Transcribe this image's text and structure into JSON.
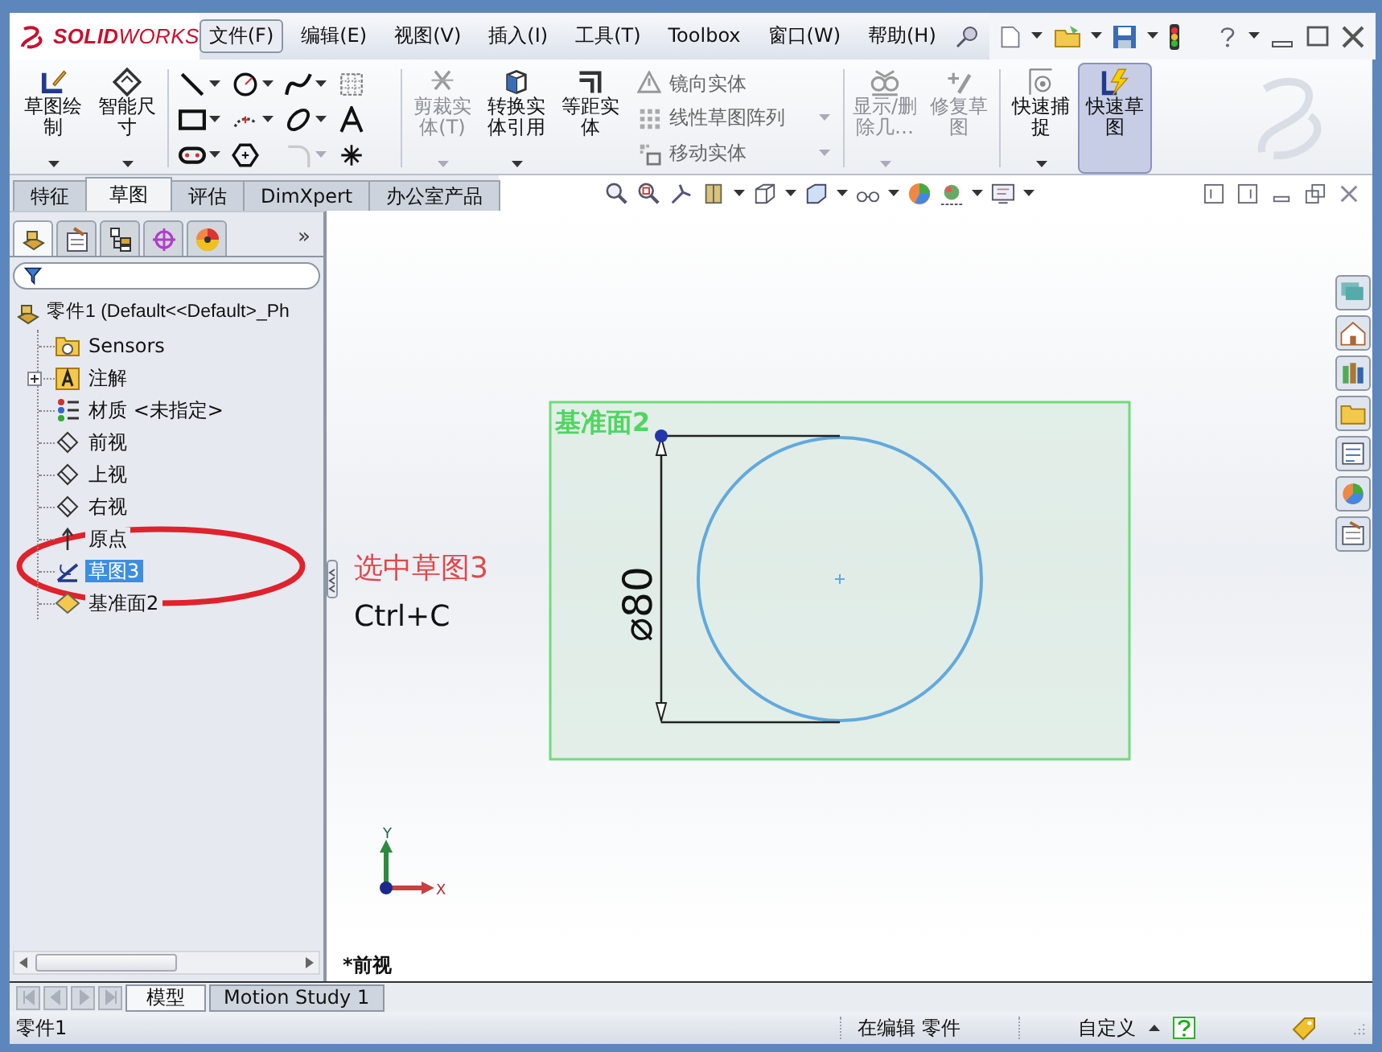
{
  "logo": {
    "text": "**SOLID**WORKS"
  },
  "menu": [
    {
      "label": "文件(F)",
      "selected": true
    },
    {
      "label": "编辑(E)",
      "selected": false
    },
    {
      "label": "视图(V)",
      "selected": false
    },
    {
      "label": "插入(I)",
      "selected": false
    },
    {
      "label": "工具(T)",
      "selected": false
    },
    {
      "label": "Toolbox",
      "selected": false
    },
    {
      "label": "窗口(W)",
      "selected": false
    },
    {
      "label": "帮助(H)",
      "selected": false
    }
  ],
  "command_groups": [
    [
      {
        "kind": "large",
        "label": "草图绘制",
        "caret": true,
        "disabled": false,
        "selected": false
      },
      {
        "kind": "large",
        "label": "智能尺寸",
        "caret": true,
        "disabled": false,
        "selected": false
      }
    ],
    [
      {
        "kind": "tools",
        "cells": [
          {
            "caret": true,
            "disabled": false
          },
          {
            "caret": true,
            "disabled": false
          },
          {
            "caret": true,
            "disabled": false
          },
          {
            "caret": false,
            "disabled": false
          },
          {
            "caret": true,
            "disabled": false
          },
          {
            "caret": true,
            "disabled": false
          },
          {
            "caret": true,
            "disabled": false
          },
          {
            "caret": false,
            "disabled": false
          },
          {
            "caret": true,
            "disabled": false
          },
          {
            "caret": false,
            "disabled": false
          },
          {
            "caret": true,
            "disabled": true
          },
          {
            "caret": false,
            "disabled": false
          }
        ]
      }
    ],
    [
      {
        "kind": "large",
        "label": "剪裁实体(T)",
        "caret": true,
        "disabled": true,
        "selected": false
      },
      {
        "kind": "large",
        "label": "转换实体引用",
        "caret": true,
        "disabled": false,
        "selected": false
      },
      {
        "kind": "large",
        "label": "等距实体",
        "caret": false,
        "disabled": false,
        "selected": false
      },
      {
        "kind": "stack",
        "items": [
          {
            "label": "镜向实体",
            "caret": false,
            "disabled": true
          },
          {
            "label": "线性草图阵列",
            "caret": true,
            "disabled": true
          },
          {
            "label": "移动实体",
            "caret": true,
            "disabled": true
          }
        ]
      }
    ],
    [
      {
        "kind": "large",
        "label": "显示/删除几…",
        "caret": true,
        "disabled": true,
        "selected": false
      },
      {
        "kind": "large",
        "label": "修复草图",
        "caret": false,
        "disabled": true,
        "selected": false
      }
    ],
    [
      {
        "kind": "large",
        "label": "快速捕捉",
        "caret": true,
        "disabled": false,
        "selected": false
      },
      {
        "kind": "large",
        "label": "快速草图",
        "caret": false,
        "disabled": false,
        "selected": true
      }
    ]
  ],
  "command_tabs": [
    {
      "label": "特征",
      "selected": false
    },
    {
      "label": "草图",
      "selected": true
    },
    {
      "label": "评估",
      "selected": false
    },
    {
      "label": "DimXpert",
      "selected": false
    },
    {
      "label": "办公室产品",
      "selected": false
    }
  ],
  "panel_tabs": [
    {
      "selected": true
    },
    {
      "selected": false
    },
    {
      "selected": false
    },
    {
      "selected": false
    },
    {
      "selected": false
    }
  ],
  "panel_overflow": "»",
  "tree": {
    "label": "零件1 (Default<<Default>_Ph",
    "children": [
      {
        "label": "Sensors",
        "selected": false
      },
      {
        "label": "注解",
        "selected": false,
        "expanded": false
      },
      {
        "label": "材质 <未指定>",
        "selected": false
      },
      {
        "label": "前视",
        "selected": false
      },
      {
        "label": "上视",
        "selected": false
      },
      {
        "label": "右视",
        "selected": false
      },
      {
        "label": "原点",
        "selected": false
      },
      {
        "label": "草图3",
        "selected": true
      },
      {
        "label": "基准面2",
        "selected": false
      }
    ]
  },
  "annotation": {
    "title": "选中草图3",
    "shortcut": "Ctrl+C"
  },
  "graphics": {
    "plane_label": "基准面2",
    "dimension": "⌀80",
    "view_name": "*前视",
    "triad": {
      "y": "Y",
      "x": "X"
    }
  },
  "bottom_tabs": [
    {
      "label": "模型",
      "selected": true
    },
    {
      "label": "Motion Study 1",
      "selected": false
    }
  ],
  "status_bar": {
    "document": "零件1",
    "mode": "在编辑 零件",
    "units": "自定义"
  }
}
